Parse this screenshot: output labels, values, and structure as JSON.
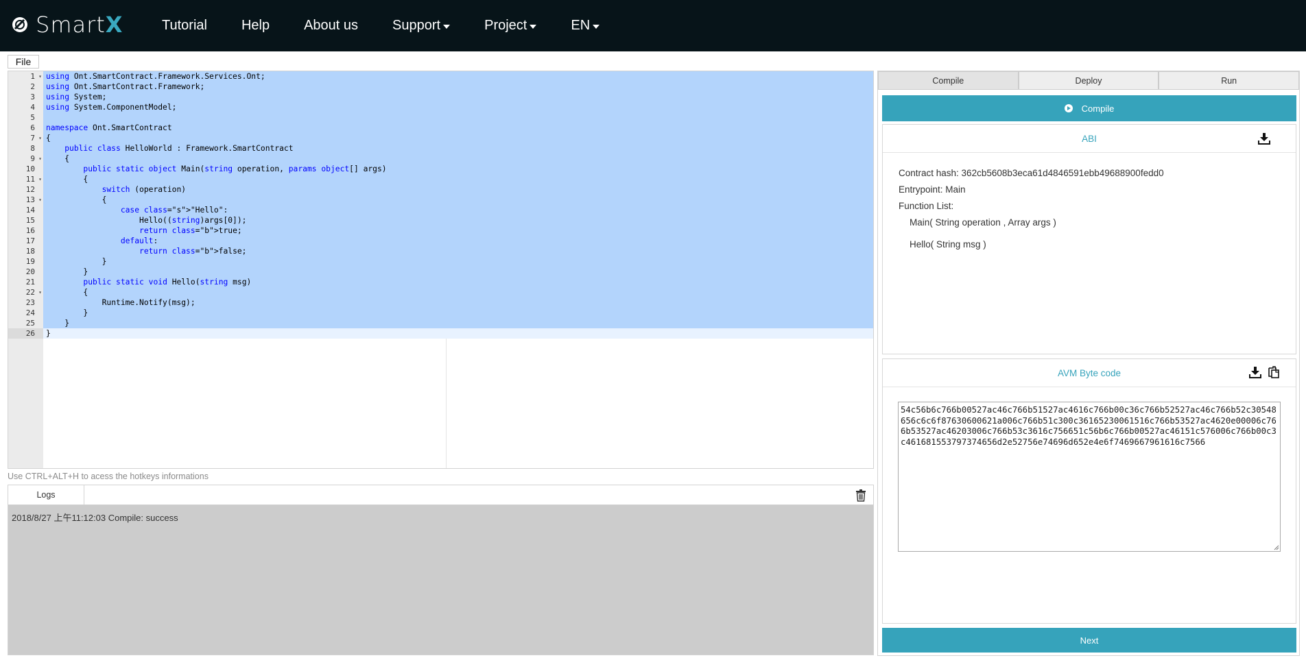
{
  "brand": {
    "name": "Smart",
    "x": "X"
  },
  "nav": {
    "items": [
      {
        "label": "Tutorial",
        "dropdown": false
      },
      {
        "label": "Help",
        "dropdown": false
      },
      {
        "label": "About us",
        "dropdown": false
      },
      {
        "label": "Support",
        "dropdown": true
      },
      {
        "label": "Project",
        "dropdown": true
      },
      {
        "label": "EN",
        "dropdown": true
      }
    ]
  },
  "toolbar": {
    "file_label": "File"
  },
  "editor": {
    "line_numbers": [
      "1",
      "2",
      "3",
      "4",
      "5",
      "6",
      "7",
      "8",
      "9",
      "10",
      "11",
      "12",
      "13",
      "14",
      "15",
      "16",
      "17",
      "18",
      "19",
      "20",
      "21",
      "22",
      "23",
      "24",
      "25",
      "26"
    ],
    "folded_lines": [
      1,
      7,
      9,
      11,
      13,
      22
    ],
    "lines": [
      "using Ont.SmartContract.Framework.Services.Ont;",
      "using Ont.SmartContract.Framework;",
      "using System;",
      "using System.ComponentModel;",
      "",
      "namespace Ont.SmartContract",
      "{",
      "    public class HelloWorld : Framework.SmartContract",
      "    {",
      "        public static object Main(string operation, params object[] args)",
      "        {",
      "            switch (operation)",
      "            {",
      "                case \"Hello\":",
      "                    Hello((string)args[0]);",
      "                    return true;",
      "                default:",
      "                    return false;",
      "            }",
      "        }",
      "        public static void Hello(string msg)",
      "        {",
      "            Runtime.Notify(msg);",
      "        }",
      "    }",
      "}"
    ],
    "hint": "Use CTRL+ALT+H to acess the hotkeys informations"
  },
  "logs": {
    "tab_label": "Logs",
    "entries": [
      "2018/8/27 上午11:12:03 Compile: success"
    ]
  },
  "panel": {
    "tabs": [
      "Compile",
      "Deploy",
      "Run"
    ],
    "active_tab": "Compile",
    "compile_button": "Compile",
    "abi": {
      "title": "ABI",
      "contract_hash": "Contract hash: 362cb5608b3eca61d4846591ebb49688900fedd0",
      "entrypoint": "Entrypoint: Main",
      "function_list_label": "Function List:",
      "functions": [
        "Main( String operation , Array args )",
        "Hello( String msg )"
      ]
    },
    "avm": {
      "title": "AVM Byte code",
      "bytecode": "54c56b6c766b00527ac46c766b51527ac4616c766b00c36c766b52527ac46c766b52c30548656c6c6f87630600621a006c766b51c300c36165230061516c766b53527ac4620e00006c766b53527ac46203006c766b53c3616c756651c56b6c766b00527ac46151c576006c766b00c3c461681553797374656d2e52756e74696d652e4e6f7469667961616c7566"
    },
    "next_button": "Next"
  },
  "colors": {
    "navbar": "#071419",
    "accent": "#36a3bb",
    "selection": "#b3d4fc"
  }
}
